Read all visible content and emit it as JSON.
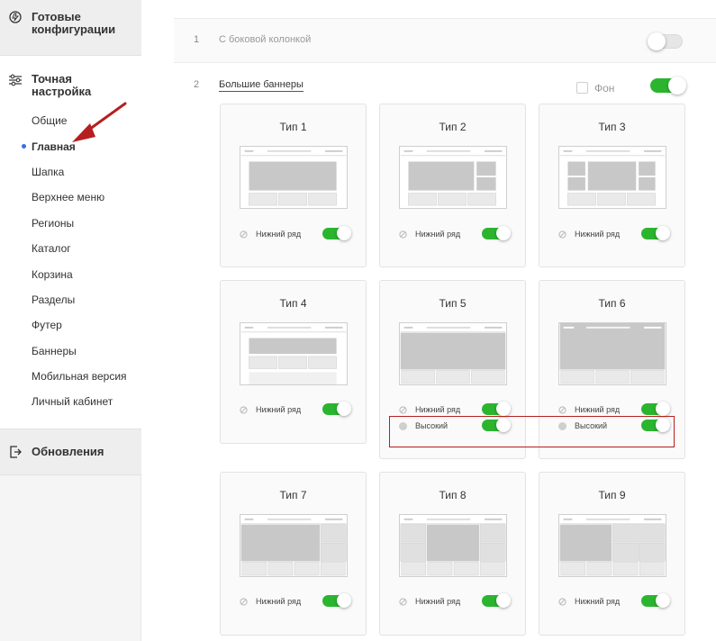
{
  "sidebar": {
    "configs": {
      "label": "Готовые конфигурации",
      "icon": "ready-configs-icon"
    },
    "tuning": {
      "label": "Точная настройка",
      "icon": "sliders-icon"
    },
    "items": [
      {
        "label": "Общие",
        "active": false
      },
      {
        "label": "Главная",
        "active": true
      },
      {
        "label": "Шапка",
        "active": false
      },
      {
        "label": "Верхнее меню",
        "active": false
      },
      {
        "label": "Регионы",
        "active": false
      },
      {
        "label": "Каталог",
        "active": false
      },
      {
        "label": "Корзина",
        "active": false
      },
      {
        "label": "Разделы",
        "active": false
      },
      {
        "label": "Футер",
        "active": false
      },
      {
        "label": "Баннеры",
        "active": false
      },
      {
        "label": "Мобильная версия",
        "active": false
      },
      {
        "label": "Личный кабинет",
        "active": false
      }
    ],
    "updates": {
      "label": "Обновления",
      "icon": "updates-icon"
    }
  },
  "rows": [
    {
      "num": "1",
      "label": "С боковой колонкой",
      "enabled": false
    },
    {
      "num": "2",
      "label": "Большие баннеры",
      "enabled": true,
      "background_label": "Фон",
      "background_checked": false
    }
  ],
  "cards": [
    {
      "title": "Тип 1",
      "options": [
        {
          "label": "Нижний ряд",
          "on": true
        }
      ]
    },
    {
      "title": "Тип 2",
      "options": [
        {
          "label": "Нижний ряд",
          "on": true
        }
      ]
    },
    {
      "title": "Тип 3",
      "options": [
        {
          "label": "Нижний ряд",
          "on": true
        }
      ]
    },
    {
      "title": "Тип 4",
      "options": [
        {
          "label": "Нижний ряд",
          "on": true
        }
      ]
    },
    {
      "title": "Тип 5",
      "options": [
        {
          "label": "Нижний ряд",
          "on": true
        },
        {
          "label": "Высокий",
          "on": true
        }
      ]
    },
    {
      "title": "Тип 6",
      "options": [
        {
          "label": "Нижний ряд",
          "on": true
        },
        {
          "label": "Высокий",
          "on": true
        }
      ]
    },
    {
      "title": "Тип 7",
      "options": [
        {
          "label": "Нижний ряд",
          "on": true
        }
      ]
    },
    {
      "title": "Тип 8",
      "options": [
        {
          "label": "Нижний ряд",
          "on": true
        }
      ]
    },
    {
      "title": "Тип 9",
      "options": [
        {
          "label": "Нижний ряд",
          "on": true
        }
      ]
    }
  ],
  "colors": {
    "toggle_on": "#2bb52f",
    "active_dot": "#3b6fe0",
    "annotation_red": "#b51f1f"
  }
}
